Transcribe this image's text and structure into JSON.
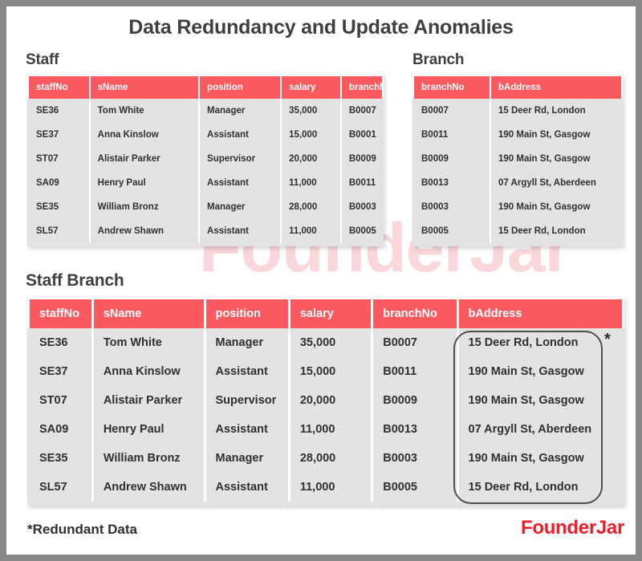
{
  "title": "Data Redundancy and Update Anomalies",
  "watermark": "FounderJar",
  "staff_table": {
    "label": "Staff",
    "columns": [
      "staffNo",
      "sName",
      "position",
      "salary",
      "branchNo"
    ],
    "rows": [
      [
        "SE36",
        "Tom White",
        "Manager",
        "35,000",
        "B0007"
      ],
      [
        "SE37",
        "Anna Kinslow",
        "Assistant",
        "15,000",
        "B0001"
      ],
      [
        "ST07",
        "Alistair Parker",
        "Supervisor",
        "20,000",
        "B0009"
      ],
      [
        "SA09",
        "Henry Paul",
        "Assistant",
        "11,000",
        "B0011"
      ],
      [
        "SE35",
        "William Bronz",
        "Manager",
        "28,000",
        "B0003"
      ],
      [
        "SL57",
        "Andrew Shawn",
        "Assistant",
        "11,000",
        "B0005"
      ]
    ]
  },
  "branch_table": {
    "label": "Branch",
    "columns": [
      "branchNo",
      "bAddress"
    ],
    "rows": [
      [
        "B0007",
        "15 Deer Rd, London"
      ],
      [
        "B0011",
        "190 Main St, Gasgow"
      ],
      [
        "B0009",
        "190 Main St, Gasgow"
      ],
      [
        "B0013",
        "07 Argyll St, Aberdeen"
      ],
      [
        "B0003",
        "190 Main St, Gasgow"
      ],
      [
        "B0005",
        "15 Deer Rd, London"
      ]
    ]
  },
  "staff_branch_table": {
    "label": "Staff Branch",
    "columns": [
      "staffNo",
      "sName",
      "position",
      "salary",
      "branchNo",
      "bAddress"
    ],
    "rows": [
      [
        "SE36",
        "Tom White",
        "Manager",
        "35,000",
        "B0007",
        "15 Deer Rd, London"
      ],
      [
        "SE37",
        "Anna Kinslow",
        "Assistant",
        "15,000",
        "B0011",
        "190 Main St, Gasgow"
      ],
      [
        "ST07",
        "Alistair Parker",
        "Supervisor",
        "20,000",
        "B0009",
        "190 Main St, Gasgow"
      ],
      [
        "SA09",
        "Henry Paul",
        "Assistant",
        "11,000",
        "B0013",
        "07 Argyll St, Aberdeen"
      ],
      [
        "SE35",
        "William Bronz",
        "Manager",
        "28,000",
        "B0003",
        "190 Main St, Gasgow"
      ],
      [
        "SL57",
        "Andrew Shawn",
        "Assistant",
        "11,000",
        "B0005",
        "15 Deer Rd, London"
      ]
    ],
    "redundancy_marker": "*"
  },
  "footnote": "*Redundant Data",
  "brand": "FounderJar",
  "colors": {
    "header_red": "#fa5a5f",
    "cell_gray": "#e3e3e3",
    "text_dark": "#303030",
    "brand_red": "#f01e28",
    "page_border": "#878787"
  }
}
